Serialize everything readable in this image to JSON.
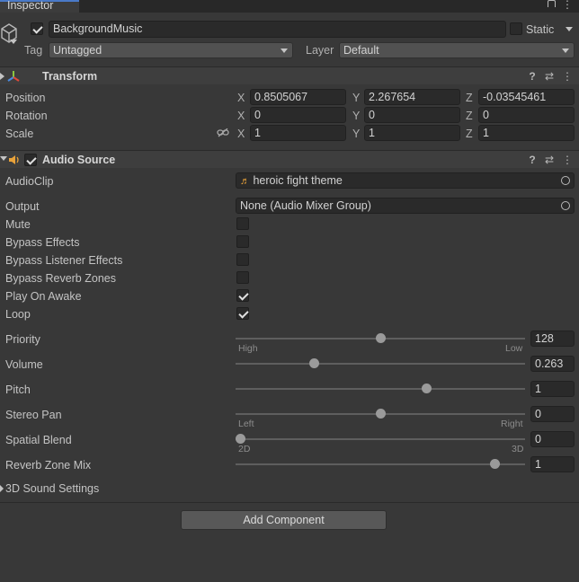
{
  "window": {
    "tab_label": "Inspector"
  },
  "header": {
    "object_name": "BackgroundMusic",
    "active": true,
    "static_label": "Static",
    "static_checked": false,
    "tag_label": "Tag",
    "tag_value": "Untagged",
    "layer_label": "Layer",
    "layer_value": "Default"
  },
  "transform": {
    "title": "Transform",
    "rows": [
      {
        "label": "Position",
        "x": "0.8505067",
        "y": "2.267654",
        "z": "-0.03545461"
      },
      {
        "label": "Rotation",
        "x": "0",
        "y": "0",
        "z": "0"
      },
      {
        "label": "Scale",
        "x": "1",
        "y": "1",
        "z": "1"
      }
    ],
    "axes": {
      "x": "X",
      "y": "Y",
      "z": "Z"
    }
  },
  "audio_source": {
    "title": "Audio Source",
    "enabled": true,
    "audioclip_label": "AudioClip",
    "audioclip_value": "heroic fight theme",
    "output_label": "Output",
    "output_value": "None (Audio Mixer Group)",
    "toggles": [
      {
        "label": "Mute",
        "checked": false
      },
      {
        "label": "Bypass Effects",
        "checked": false
      },
      {
        "label": "Bypass Listener Effects",
        "checked": false
      },
      {
        "label": "Bypass Reverb Zones",
        "checked": false
      },
      {
        "label": "Play On Awake",
        "checked": true
      },
      {
        "label": "Loop",
        "checked": true
      }
    ],
    "sliders": [
      {
        "label": "Priority",
        "value": "128",
        "fraction": 0.5,
        "left_tick": "High",
        "right_tick": "Low"
      },
      {
        "label": "Volume",
        "value": "0.263",
        "fraction": 0.263,
        "left_tick": "",
        "right_tick": ""
      },
      {
        "label": "Pitch",
        "value": "1",
        "fraction": 0.667,
        "left_tick": "",
        "right_tick": ""
      },
      {
        "label": "Stereo Pan",
        "value": "0",
        "fraction": 0.5,
        "left_tick": "Left",
        "right_tick": "Right"
      },
      {
        "label": "Spatial Blend",
        "value": "0",
        "fraction": 0.0,
        "left_tick": "2D",
        "right_tick": "3D"
      },
      {
        "label": "Reverb Zone Mix",
        "value": "1",
        "fraction": 0.909,
        "left_tick": "",
        "right_tick": ""
      }
    ],
    "sound_3d_label": "3D Sound Settings"
  },
  "add_component_label": "Add Component",
  "colors": {
    "panel": "#383838",
    "field": "#2a2a2a",
    "header": "#3e3e3e",
    "audio_icon": "#e8a23a"
  }
}
